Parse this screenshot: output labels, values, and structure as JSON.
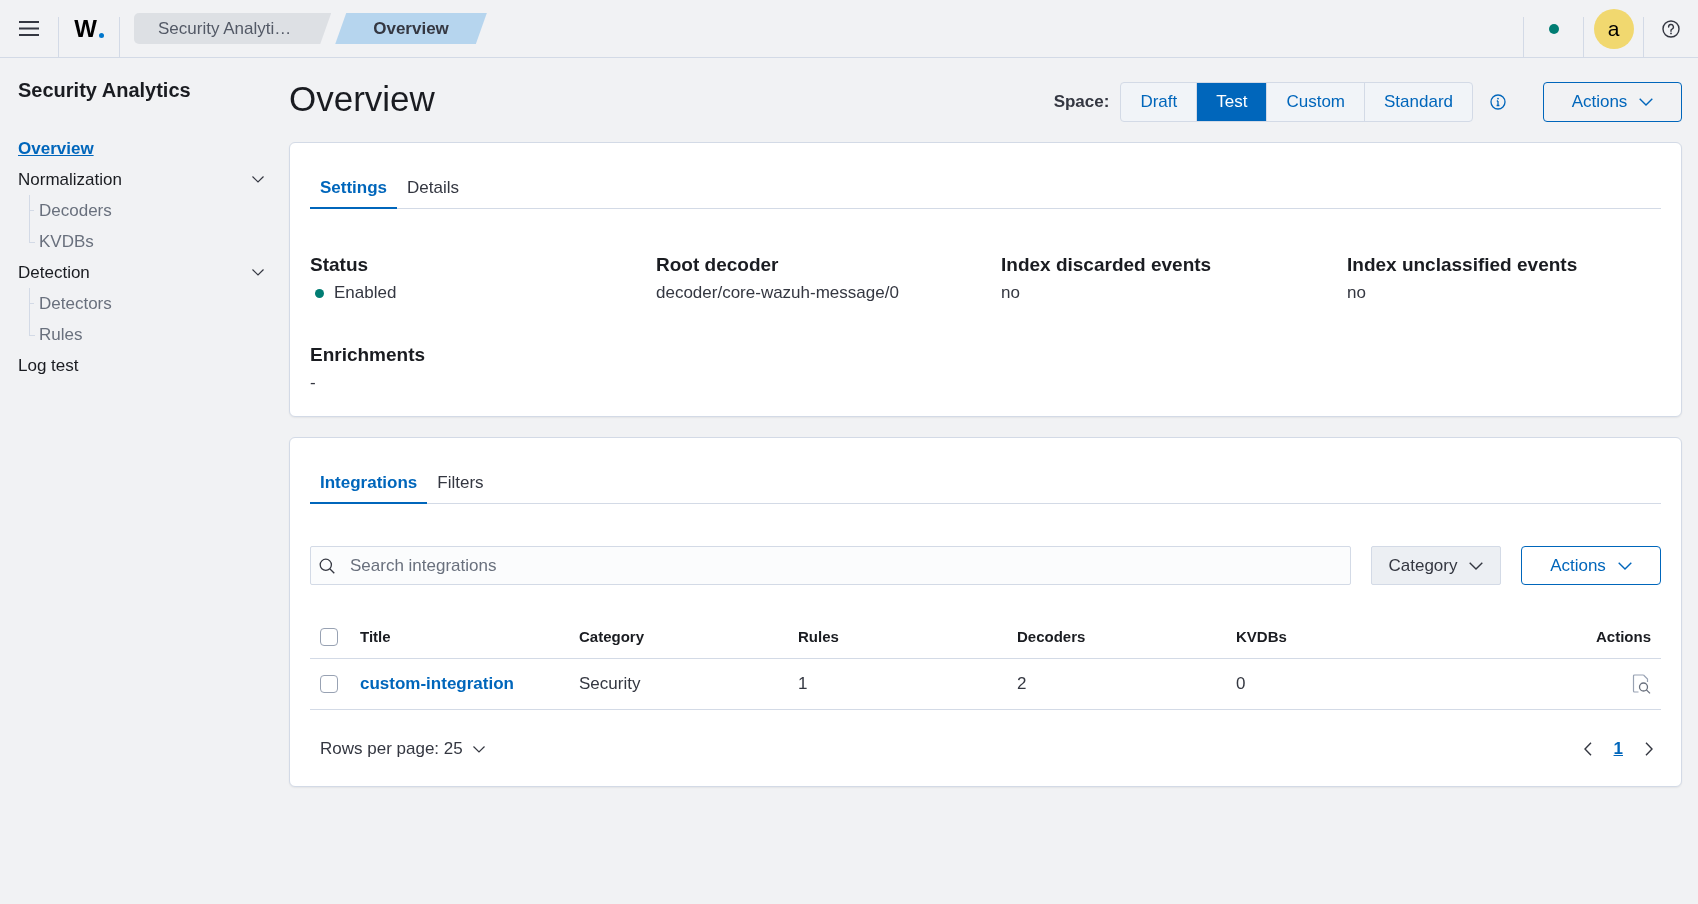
{
  "topbar": {
    "logo": "W",
    "breadcrumbs": [
      {
        "label": "Security Analyti…",
        "selected": false
      },
      {
        "label": "Overview",
        "selected": true
      }
    ],
    "avatar": "a"
  },
  "sidebar": {
    "title": "Security Analytics",
    "items": [
      {
        "label": "Overview",
        "selected": true
      },
      {
        "label": "Normalization",
        "selected": false,
        "expanded": true,
        "children": [
          {
            "label": "Decoders",
            "selected": false
          },
          {
            "label": "KVDBs",
            "selected": false
          }
        ]
      },
      {
        "label": "Detection",
        "selected": false,
        "expanded": true,
        "children": [
          {
            "label": "Detectors",
            "selected": false
          },
          {
            "label": "Rules",
            "selected": false
          }
        ]
      },
      {
        "label": "Log test",
        "selected": false
      }
    ]
  },
  "header": {
    "title": "Overview",
    "space_label": "Space:",
    "space_options": [
      {
        "label": "Draft",
        "selected": false
      },
      {
        "label": "Test",
        "selected": true
      },
      {
        "label": "Custom",
        "selected": false
      },
      {
        "label": "Standard",
        "selected": false
      }
    ],
    "actions_button": "Actions"
  },
  "settings_card": {
    "tabs": [
      {
        "label": "Settings",
        "selected": true
      },
      {
        "label": "Details",
        "selected": false
      }
    ],
    "fields": [
      {
        "label": "Status",
        "value": "Enabled",
        "kind": "status"
      },
      {
        "label": "Root decoder",
        "value": "decoder/core-wazuh-message/0",
        "kind": "text"
      },
      {
        "label": "Index discarded events",
        "value": "no",
        "kind": "text"
      },
      {
        "label": "Index unclassified events",
        "value": "no",
        "kind": "text"
      },
      {
        "label": "Enrichments",
        "value": "-",
        "kind": "text"
      }
    ]
  },
  "integrations_card": {
    "tabs": [
      {
        "label": "Integrations",
        "selected": true
      },
      {
        "label": "Filters",
        "selected": false
      }
    ],
    "search": {
      "placeholder": "Search integrations"
    },
    "category_button": "Category",
    "actions_button": "Actions",
    "table": {
      "header_checked": false,
      "columns": [
        "Title",
        "Category",
        "Rules",
        "Decoders",
        "KVDBs",
        "Actions"
      ],
      "rows": [
        {
          "checked": false,
          "cells": [
            "custom-integration",
            "Security",
            "1",
            "2",
            "0"
          ]
        }
      ]
    },
    "pagination": {
      "rows_per_page": "Rows per page: 25",
      "pages": [
        {
          "label": "1",
          "selected": true
        }
      ]
    }
  }
}
